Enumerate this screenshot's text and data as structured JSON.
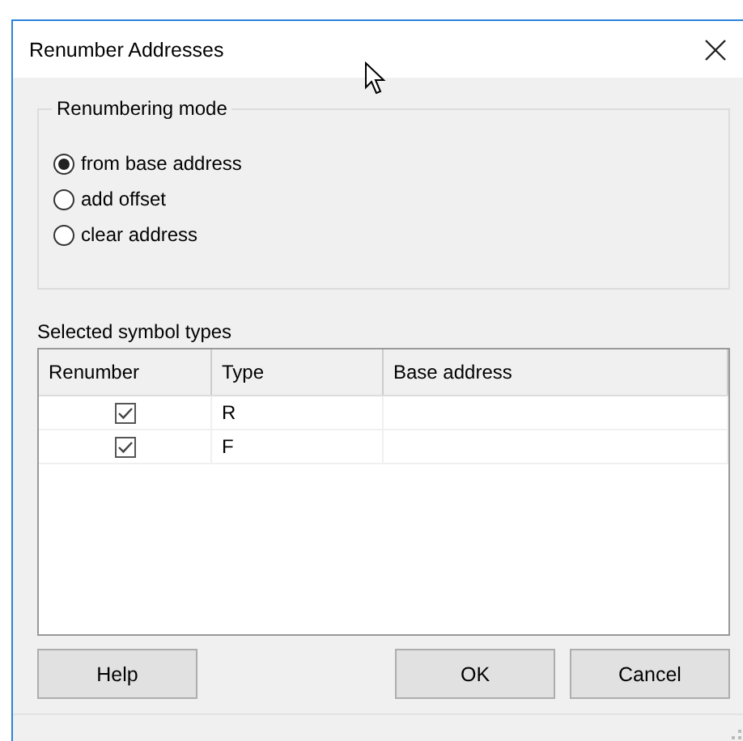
{
  "window": {
    "title": "Renumber Addresses"
  },
  "mode_group": {
    "title": "Renumbering mode",
    "options": [
      {
        "label": "from base address",
        "selected": true
      },
      {
        "label": "add offset",
        "selected": false
      },
      {
        "label": "clear address",
        "selected": false
      }
    ]
  },
  "table": {
    "label": "Selected symbol types",
    "columns": [
      "Renumber",
      "Type",
      "Base address"
    ],
    "rows": [
      {
        "checked": true,
        "type": "R"
      },
      {
        "checked": true,
        "type": "F"
      }
    ]
  },
  "buttons": [
    {
      "label": "Help"
    },
    {
      "label": "OK"
    },
    {
      "label": "Cancel"
    }
  ]
}
